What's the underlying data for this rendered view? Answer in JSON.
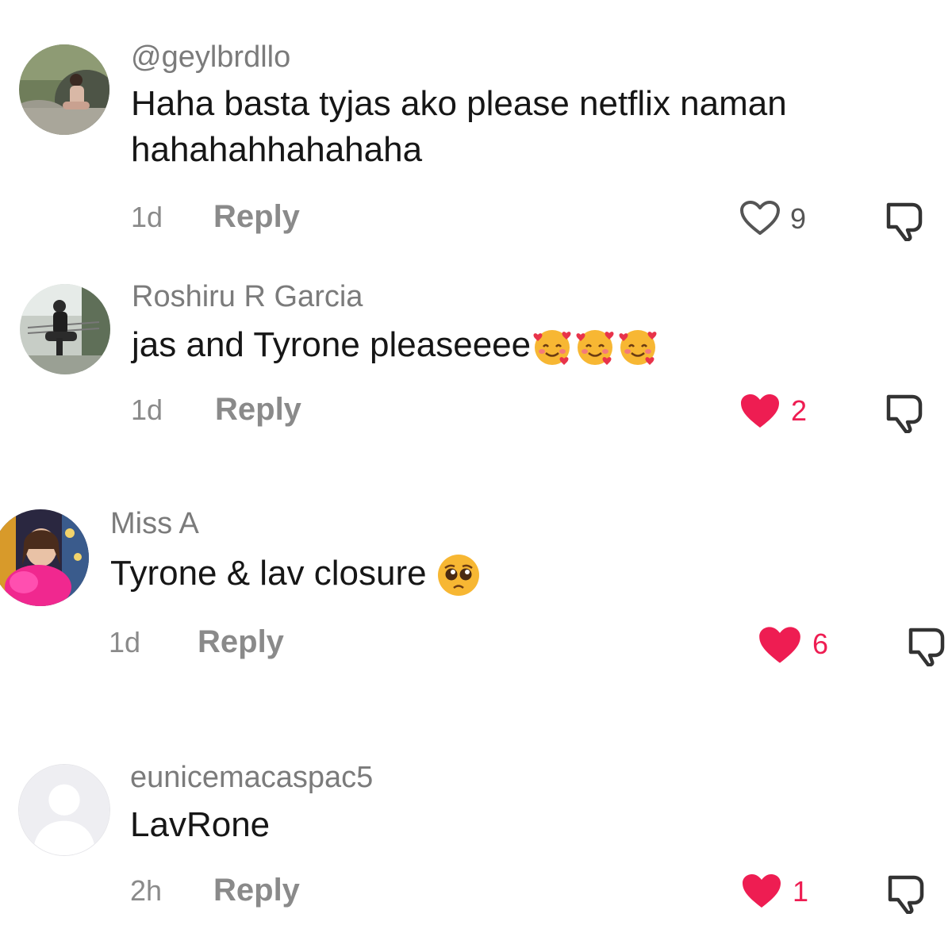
{
  "comments": [
    {
      "username": "@geylbrdllo",
      "text_line1": "Haha basta tyjas ako please netflix naman",
      "text_line2": "hahahahhahahaha",
      "timestamp": "1d",
      "reply_label": "Reply",
      "like_count": "9",
      "liked": false,
      "avatar": "photo-woman-seated-outdoors"
    },
    {
      "username": "Roshiru R Garcia",
      "text": "jas and Tyrone pleaseeee",
      "emojis": [
        "smiling-face-with-hearts",
        "smiling-face-with-hearts",
        "smiling-face-with-hearts"
      ],
      "timestamp": "1d",
      "reply_label": "Reply",
      "like_count": "2",
      "liked": true,
      "avatar": "photo-person-seated-on-balcony"
    },
    {
      "username": "Miss A",
      "text": "Tyrone & lav closure ",
      "emojis": [
        "pleading-face"
      ],
      "timestamp": "1d",
      "reply_label": "Reply",
      "like_count": "6",
      "liked": true,
      "avatar": "photo-woman-with-pink-outfit"
    },
    {
      "username": "eunicemacaspac5",
      "text": "LavRone",
      "timestamp": "2h",
      "reply_label": "Reply",
      "like_count": "1",
      "liked": true,
      "avatar": "default-user-silhouette"
    }
  ],
  "colors": {
    "like_active": "#ee1d52",
    "like_inactive": "#555555",
    "muted_text": "#8a8a8a",
    "username": "#7b7b7b",
    "body_text": "#161616"
  }
}
